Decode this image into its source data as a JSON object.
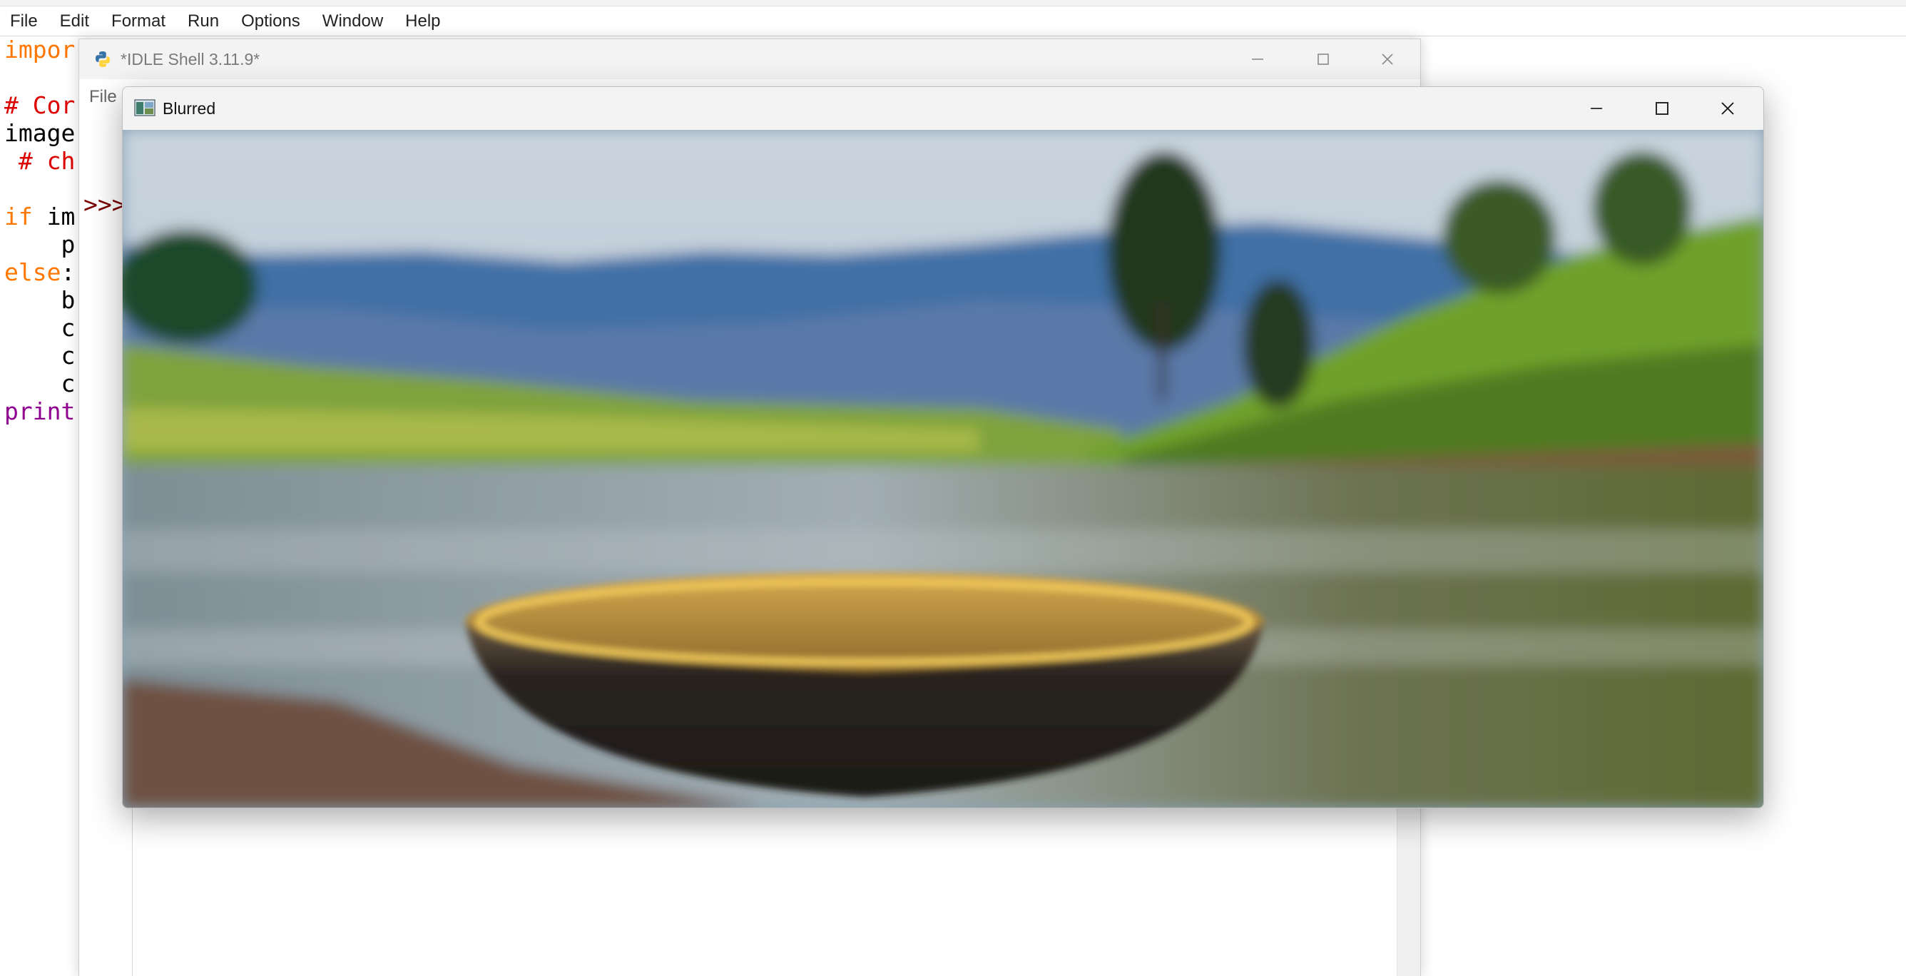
{
  "editor": {
    "menu": [
      "File",
      "Edit",
      "Format",
      "Run",
      "Options",
      "Window",
      "Help"
    ],
    "code_lines": [
      [
        {
          "t": "impor",
          "c": "kw"
        }
      ],
      [],
      [
        {
          "t": "# Cor",
          "c": "cm"
        }
      ],
      [
        {
          "t": "image",
          "c": "pl"
        }
      ],
      [
        {
          "t": " # ch",
          "c": "cm"
        }
      ],
      [],
      [
        {
          "t": "if",
          "c": "kw"
        },
        {
          "t": " im",
          "c": "pl"
        }
      ],
      [
        {
          "t": "    p",
          "c": "pl"
        }
      ],
      [
        {
          "t": "else",
          "c": "kw"
        },
        {
          "t": ":",
          "c": "pl"
        }
      ],
      [
        {
          "t": "    b",
          "c": "pl"
        }
      ],
      [
        {
          "t": "    c",
          "c": "pl"
        }
      ],
      [
        {
          "t": "    c",
          "c": "pl"
        }
      ],
      [
        {
          "t": "    c",
          "c": "pl"
        }
      ],
      [
        {
          "t": "print",
          "c": "bi"
        }
      ]
    ]
  },
  "shell": {
    "title": "*IDLE Shell 3.11.9*",
    "menu_file": "File",
    "prompt": ">>>"
  },
  "blurred_window": {
    "title": "Blurred",
    "image_description": "Blurred photo of a woven coracle boat on a lake shore with green hills and trees"
  },
  "icons": {
    "minimize": "minimize-icon",
    "maximize": "maximize-icon",
    "close": "close-icon",
    "python": "python-icon",
    "image_app": "image-window-icon"
  }
}
